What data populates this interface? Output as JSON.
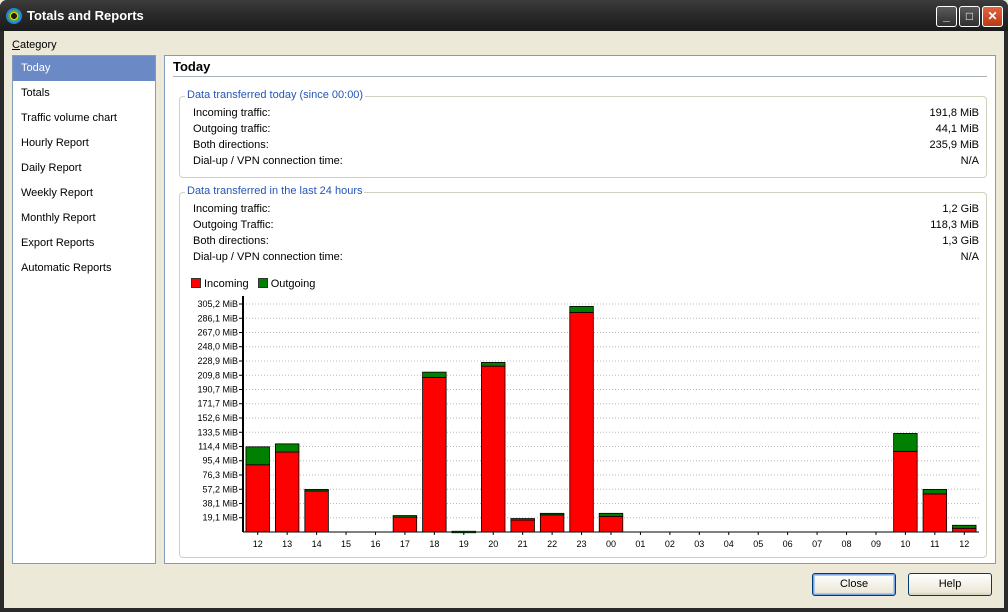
{
  "window": {
    "title": "Totals and Reports"
  },
  "category_label": {
    "accel": "C",
    "rest": "ategory"
  },
  "sidebar": {
    "items": [
      {
        "label": "Today"
      },
      {
        "label": "Totals"
      },
      {
        "label": "Traffic volume chart"
      },
      {
        "label": "Hourly Report"
      },
      {
        "label": "Daily Report"
      },
      {
        "label": "Weekly Report"
      },
      {
        "label": "Monthly Report"
      },
      {
        "label": "Export Reports"
      },
      {
        "label": "Automatic Reports"
      }
    ],
    "active_index": 0
  },
  "main": {
    "title": "Today",
    "today_group": {
      "legend": "Data transferred today (since 00:00)",
      "rows": [
        {
          "label": "Incoming traffic:",
          "value": "191,8 MiB"
        },
        {
          "label": "Outgoing traffic:",
          "value": "44,1 MiB"
        },
        {
          "label": "Both directions:",
          "value": "235,9 MiB"
        },
        {
          "label": "Dial-up / VPN connection time:",
          "value": "N/A"
        }
      ]
    },
    "last24_group": {
      "legend": "Data transferred in the last 24 hours",
      "rows": [
        {
          "label": "Incoming traffic:",
          "value": "1,2 GiB"
        },
        {
          "label": "Outgoing Traffic:",
          "value": "118,3 MiB"
        },
        {
          "label": "Both directions:",
          "value": "1,3 GiB"
        },
        {
          "label": "Dial-up / VPN connection time:",
          "value": "N/A"
        }
      ]
    }
  },
  "chart_data": {
    "type": "bar",
    "stacked": true,
    "categories": [
      "12",
      "13",
      "14",
      "15",
      "16",
      "17",
      "18",
      "19",
      "20",
      "21",
      "22",
      "23",
      "00",
      "01",
      "02",
      "03",
      "04",
      "05",
      "06",
      "07",
      "08",
      "09",
      "10",
      "11",
      "12"
    ],
    "series": [
      {
        "name": "Incoming",
        "color": "#ff0000",
        "values": [
          90,
          107,
          55,
          0,
          0,
          20,
          207,
          0,
          222,
          16,
          23,
          294,
          21,
          0,
          0,
          0,
          0,
          0,
          0,
          0,
          0,
          0,
          108,
          51,
          5
        ]
      },
      {
        "name": "Outgoing",
        "color": "#008000",
        "values": [
          24,
          11,
          2,
          0,
          0,
          2,
          7,
          1,
          5,
          2,
          2,
          8,
          4,
          0,
          0,
          0,
          0,
          0,
          0,
          0,
          0,
          0,
          24,
          6,
          4
        ]
      }
    ],
    "y_ticks": [
      "19,1 MiB",
      "38,1 MiB",
      "57,2 MiB",
      "76,3 MiB",
      "95,4 MiB",
      "114,4 MiB",
      "133,5 MiB",
      "152,6 MiB",
      "171,7 MiB",
      "190,7 MiB",
      "209,8 MiB",
      "228,9 MiB",
      "248,0 MiB",
      "267,0 MiB",
      "286,1 MiB",
      "305,2 MiB"
    ],
    "y_tick_values": [
      19.1,
      38.1,
      57.2,
      76.3,
      95.4,
      114.4,
      133.5,
      152.6,
      171.7,
      190.7,
      209.8,
      228.9,
      248.0,
      267.0,
      286.1,
      305.2
    ],
    "ylim": [
      0,
      305.2
    ],
    "grid": true,
    "legend_position": "top-left"
  },
  "buttons": {
    "close": "Close",
    "help": "Help"
  }
}
